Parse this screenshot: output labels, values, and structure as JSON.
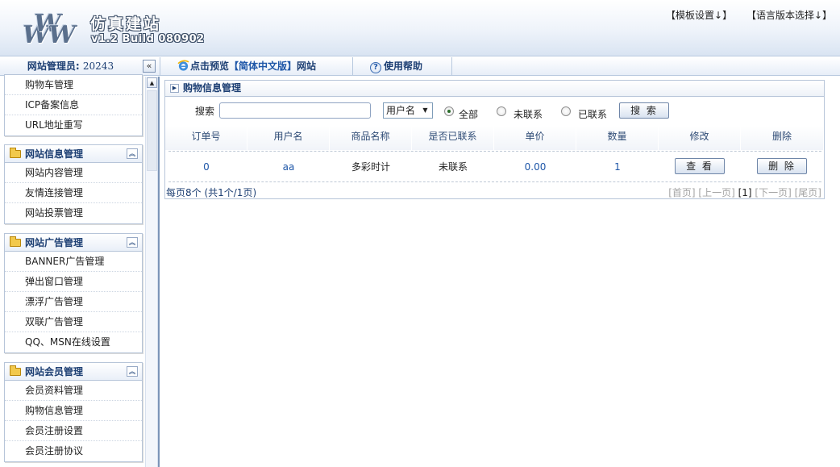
{
  "header": {
    "site_title": "仿真建站",
    "version": "v1.2 Build 080902",
    "template_link": "【模板设置↓】",
    "language_link": "【语言版本选择↓】"
  },
  "navbar": {
    "admin_label": "网站管理员:",
    "admin_id": "20243",
    "collapse_glyph": "«",
    "preview_prefix": "点击预览",
    "preview_version": "【简体中文版】",
    "preview_suffix": "网站",
    "help_label": "使用帮助"
  },
  "sidebar": {
    "scroll_up_glyph": "▲",
    "partial_items": [
      "购物车管理",
      "ICP备案信息",
      "URL地址重写"
    ],
    "groups": [
      {
        "title": "网站信息管理",
        "items": [
          "网站内容管理",
          "友情连接管理",
          "网站投票管理"
        ]
      },
      {
        "title": "网站广告管理",
        "items": [
          "BANNER广告管理",
          "弹出窗口管理",
          "漂浮广告管理",
          "双联广告管理",
          "QQ、MSN在线设置"
        ]
      },
      {
        "title": "网站会员管理",
        "items": [
          "会员资料管理",
          "购物信息管理",
          "会员注册设置",
          "会员注册协议"
        ]
      }
    ],
    "collapse_glyph": "︽"
  },
  "panel": {
    "title": "购物信息管理",
    "search": {
      "label": "搜索",
      "value": "",
      "select_value": "用户名",
      "radio_all": "全部",
      "radio_uncontacted": "未联系",
      "radio_contacted": "已联系",
      "button": "搜 索"
    },
    "columns": [
      "订单号",
      "用户名",
      "商品名称",
      "是否已联系",
      "单价",
      "数量",
      "修改",
      "删除"
    ],
    "rows": [
      {
        "order_no": "0",
        "username": "aa",
        "product": "多彩时计",
        "contacted": "未联系",
        "price": "0.00",
        "qty": "1",
        "view_btn": "查 看",
        "delete_btn": "删 除"
      }
    ],
    "pager": {
      "summary": "每页8个 (共1个/1页)",
      "first": "[首页]",
      "prev": "[上一页]",
      "current": "[1]",
      "next": "[下一页]",
      "last": "[尾页]"
    }
  },
  "colors": {
    "accent": "#1d3f73",
    "link": "#1f57a8",
    "border": "#b7c5d9"
  }
}
